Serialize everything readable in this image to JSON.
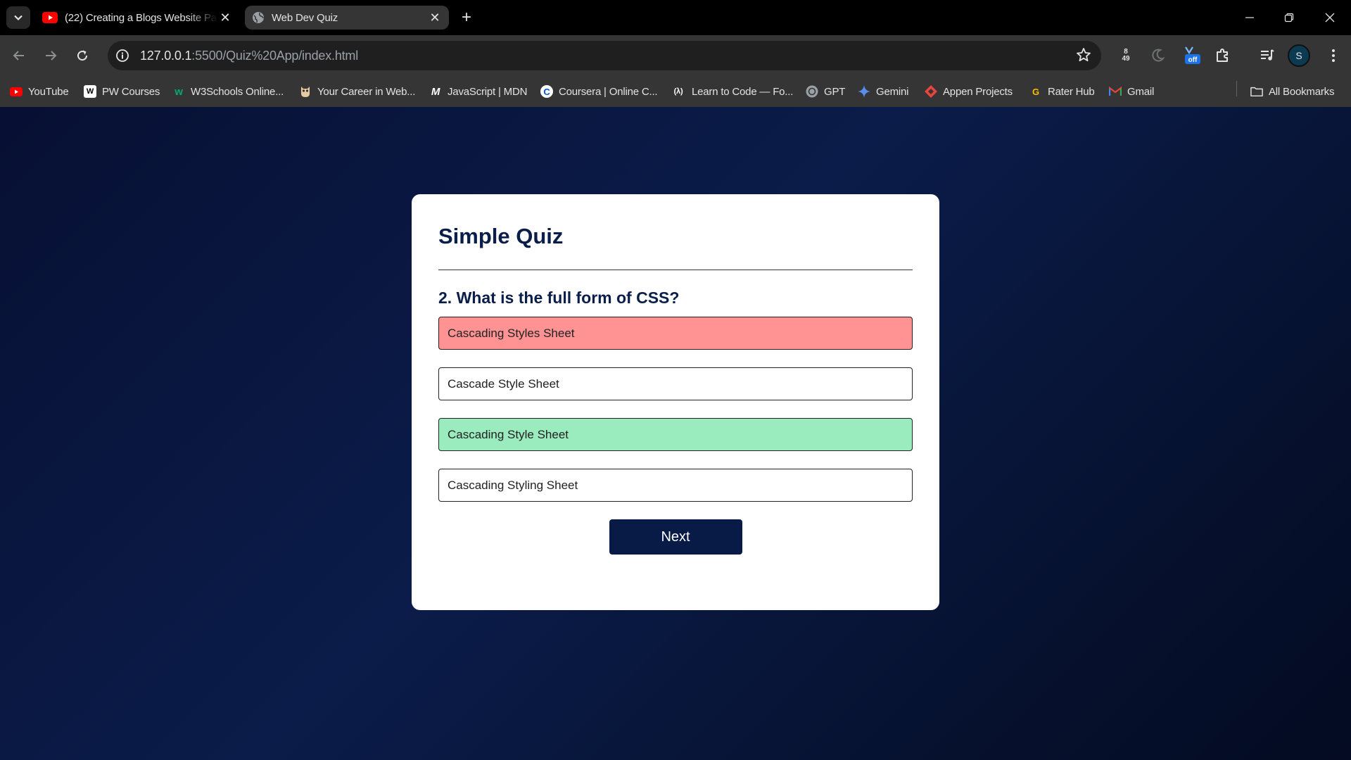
{
  "browser": {
    "tabs": [
      {
        "title": "(22) Creating a Blogs Website Pa",
        "icon": "youtube-icon",
        "active": false
      },
      {
        "title": "Web Dev Quiz",
        "icon": "globe-icon",
        "active": true
      }
    ],
    "address": {
      "host": "127.0.0.1",
      "path": ":5500/Quiz%20App/index.html"
    },
    "extension_badge": {
      "top": "8",
      "bottom": "49",
      "toggle": "off"
    },
    "profile_initial": "S",
    "bookmarks": [
      {
        "label": "YouTube",
        "icon": "youtube-icon"
      },
      {
        "label": "PW Courses",
        "icon": "pw-icon"
      },
      {
        "label": "W3Schools Online...",
        "icon": "w3schools-icon"
      },
      {
        "label": "Your Career in Web...",
        "icon": "owl-icon"
      },
      {
        "label": "JavaScript | MDN",
        "icon": "mdn-icon"
      },
      {
        "label": "Coursera | Online C...",
        "icon": "coursera-icon"
      },
      {
        "label": "Learn to Code — Fo...",
        "icon": "freecodecamp-icon"
      },
      {
        "label": "GPT",
        "icon": "chatgpt-icon"
      },
      {
        "label": "Gemini",
        "icon": "gemini-icon"
      },
      {
        "label": "Appen Projects",
        "icon": "appen-icon"
      },
      {
        "label": "Rater Hub",
        "icon": "raterhub-icon"
      },
      {
        "label": "Gmail",
        "icon": "gmail-icon"
      }
    ],
    "all_bookmarks": "All Bookmarks"
  },
  "quiz": {
    "title": "Simple Quiz",
    "question": "2. What is the full form of CSS?",
    "answers": [
      {
        "text": "Cascading Styles Sheet",
        "state": "incorrect"
      },
      {
        "text": "Cascade Style Sheet",
        "state": "neutral"
      },
      {
        "text": "Cascading Style Sheet",
        "state": "correct"
      },
      {
        "text": "Cascading Styling Sheet",
        "state": "neutral"
      }
    ],
    "next_label": "Next"
  },
  "colors": {
    "incorrect": "#ff9393",
    "correct": "#9aebbe",
    "primary": "#081b46"
  }
}
